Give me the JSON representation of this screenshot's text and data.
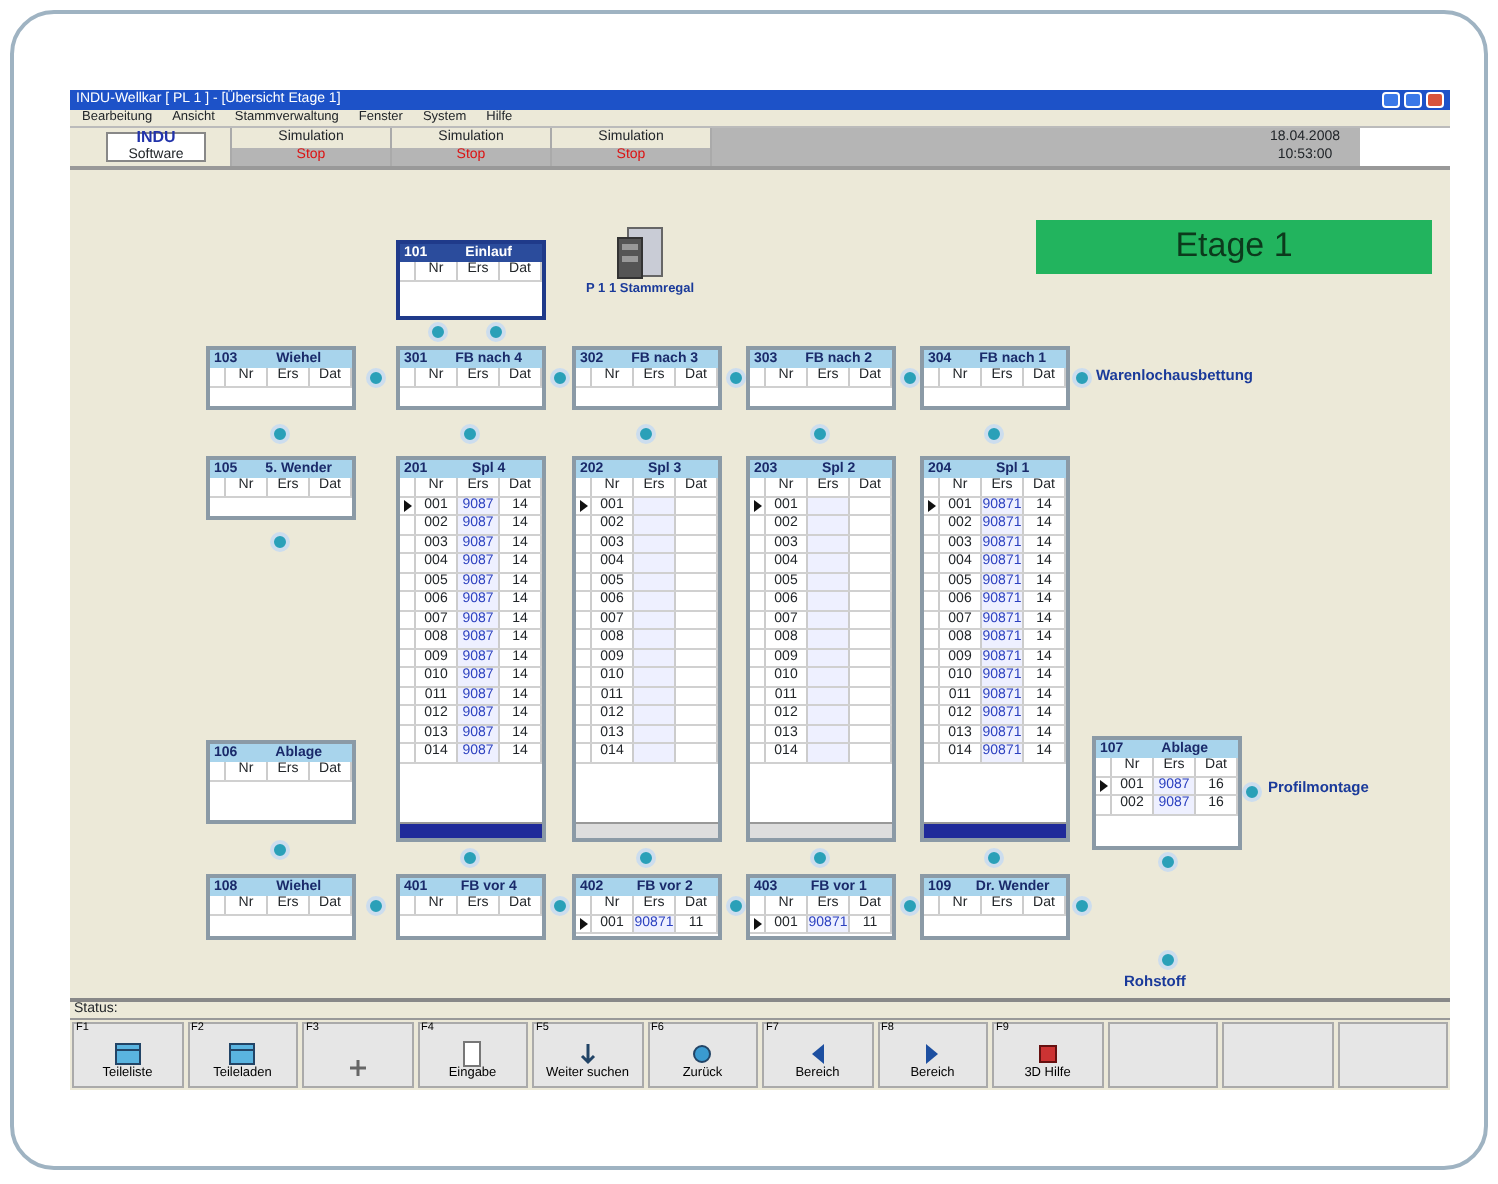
{
  "window": {
    "title": "INDU-Wellkar [ PL 1 ] - [Übersicht Etage 1]"
  },
  "menu": [
    "Bearbeitung",
    "Ansicht",
    "Stammverwaltung",
    "Fenster",
    "System",
    "Hilfe"
  ],
  "toolbar": {
    "logo": "INDU",
    "logo_sub": "Software",
    "modes": [
      {
        "label": "Simulation",
        "state": "Stop"
      },
      {
        "label": "Simulation",
        "state": "Stop"
      },
      {
        "label": "Simulation",
        "state": "Stop"
      }
    ],
    "date": "18.04.2008",
    "time": "10:53:00"
  },
  "floor": {
    "label": "Etage 1"
  },
  "storage": {
    "label": "P 1 1 Stammregal"
  },
  "labels": [
    {
      "kind": "right",
      "text": "Warenlochausbettung"
    },
    {
      "kind": "side",
      "text": "Profilmontage"
    },
    {
      "kind": "below",
      "text": "Rohstoff"
    }
  ],
  "nodes": [
    {
      "number": "101",
      "title": "Einlauf",
      "highlight": true,
      "columns": [
        "Nr",
        "Ers",
        "Dat"
      ]
    },
    {
      "number": "103",
      "title": "Wiehel",
      "highlight": false,
      "columns": [
        "Nr",
        "Ers",
        "Dat"
      ]
    },
    {
      "number": "301",
      "title": "FB nach 4",
      "highlight": false,
      "columns": [
        "Nr",
        "Ers",
        "Dat"
      ]
    },
    {
      "number": "302",
      "title": "FB nach 3",
      "highlight": false,
      "columns": [
        "Nr",
        "Ers",
        "Dat"
      ]
    },
    {
      "number": "303",
      "title": "FB nach 2",
      "highlight": false,
      "columns": [
        "Nr",
        "Ers",
        "Dat"
      ]
    },
    {
      "number": "304",
      "title": "FB nach 1",
      "highlight": false,
      "columns": [
        "Nr",
        "Ers",
        "Dat"
      ]
    },
    {
      "number": "105",
      "title": "5. Wender",
      "highlight": false,
      "columns": [
        "Nr",
        "Ers",
        "Dat"
      ]
    },
    {
      "number": "201",
      "title": "Spl 4",
      "highlight": false,
      "footer_active": true,
      "columns": [
        "Nr",
        "Ers",
        "Dat"
      ],
      "rows": [
        {
          "selected": true,
          "cells": [
            "001",
            "9087",
            "14"
          ]
        },
        {
          "selected": false,
          "cells": [
            "002",
            "9087",
            "14"
          ]
        },
        {
          "selected": false,
          "cells": [
            "003",
            "9087",
            "14"
          ]
        },
        {
          "selected": false,
          "cells": [
            "004",
            "9087",
            "14"
          ]
        },
        {
          "selected": false,
          "cells": [
            "005",
            "9087",
            "14"
          ]
        },
        {
          "selected": false,
          "cells": [
            "006",
            "9087",
            "14"
          ]
        },
        {
          "selected": false,
          "cells": [
            "007",
            "9087",
            "14"
          ]
        },
        {
          "selected": false,
          "cells": [
            "008",
            "9087",
            "14"
          ]
        },
        {
          "selected": false,
          "cells": [
            "009",
            "9087",
            "14"
          ]
        },
        {
          "selected": false,
          "cells": [
            "010",
            "9087",
            "14"
          ]
        },
        {
          "selected": false,
          "cells": [
            "011",
            "9087",
            "14"
          ]
        },
        {
          "selected": false,
          "cells": [
            "012",
            "9087",
            "14"
          ]
        },
        {
          "selected": false,
          "cells": [
            "013",
            "9087",
            "14"
          ]
        },
        {
          "selected": false,
          "cells": [
            "014",
            "9087",
            "14"
          ]
        }
      ]
    },
    {
      "number": "202",
      "title": "Spl 3",
      "highlight": false,
      "footer_active": false,
      "columns": [
        "Nr",
        "Ers",
        "Dat"
      ],
      "rows": [
        {
          "selected": true,
          "cells": [
            "001"
          ]
        },
        {
          "selected": false,
          "cells": [
            "002"
          ]
        },
        {
          "selected": false,
          "cells": [
            "003"
          ]
        },
        {
          "selected": false,
          "cells": [
            "004"
          ]
        },
        {
          "selected": false,
          "cells": [
            "005"
          ]
        },
        {
          "selected": false,
          "cells": [
            "006"
          ]
        },
        {
          "selected": false,
          "cells": [
            "007"
          ]
        },
        {
          "selected": false,
          "cells": [
            "008"
          ]
        },
        {
          "selected": false,
          "cells": [
            "009"
          ]
        },
        {
          "selected": false,
          "cells": [
            "010"
          ]
        },
        {
          "selected": false,
          "cells": [
            "011"
          ]
        },
        {
          "selected": false,
          "cells": [
            "012"
          ]
        },
        {
          "selected": false,
          "cells": [
            "013"
          ]
        },
        {
          "selected": false,
          "cells": [
            "014"
          ]
        }
      ]
    },
    {
      "number": "203",
      "title": "Spl 2",
      "highlight": false,
      "footer_active": false,
      "columns": [
        "Nr",
        "Ers",
        "Dat"
      ],
      "rows": [
        {
          "selected": true,
          "cells": [
            "001"
          ]
        },
        {
          "selected": false,
          "cells": [
            "002"
          ]
        },
        {
          "selected": false,
          "cells": [
            "003"
          ]
        },
        {
          "selected": false,
          "cells": [
            "004"
          ]
        },
        {
          "selected": false,
          "cells": [
            "005"
          ]
        },
        {
          "selected": false,
          "cells": [
            "006"
          ]
        },
        {
          "selected": false,
          "cells": [
            "007"
          ]
        },
        {
          "selected": false,
          "cells": [
            "008"
          ]
        },
        {
          "selected": false,
          "cells": [
            "009"
          ]
        },
        {
          "selected": false,
          "cells": [
            "010"
          ]
        },
        {
          "selected": false,
          "cells": [
            "011"
          ]
        },
        {
          "selected": false,
          "cells": [
            "012"
          ]
        },
        {
          "selected": false,
          "cells": [
            "013"
          ]
        },
        {
          "selected": false,
          "cells": [
            "014"
          ]
        }
      ]
    },
    {
      "number": "204",
      "title": "Spl 1",
      "highlight": false,
      "footer_active": true,
      "columns": [
        "Nr",
        "Ers",
        "Dat"
      ],
      "rows": [
        {
          "selected": true,
          "cells": [
            "001",
            "90871",
            "14"
          ]
        },
        {
          "selected": false,
          "cells": [
            "002",
            "90871",
            "14"
          ]
        },
        {
          "selected": false,
          "cells": [
            "003",
            "90871",
            "14"
          ]
        },
        {
          "selected": false,
          "cells": [
            "004",
            "90871",
            "14"
          ]
        },
        {
          "selected": false,
          "cells": [
            "005",
            "90871",
            "14"
          ]
        },
        {
          "selected": false,
          "cells": [
            "006",
            "90871",
            "14"
          ]
        },
        {
          "selected": false,
          "cells": [
            "007",
            "90871",
            "14"
          ]
        },
        {
          "selected": false,
          "cells": [
            "008",
            "90871",
            "14"
          ]
        },
        {
          "selected": false,
          "cells": [
            "009",
            "90871",
            "14"
          ]
        },
        {
          "selected": false,
          "cells": [
            "010",
            "90871",
            "14"
          ]
        },
        {
          "selected": false,
          "cells": [
            "011",
            "90871",
            "14"
          ]
        },
        {
          "selected": false,
          "cells": [
            "012",
            "90871",
            "14"
          ]
        },
        {
          "selected": false,
          "cells": [
            "013",
            "90871",
            "14"
          ]
        },
        {
          "selected": false,
          "cells": [
            "014",
            "90871",
            "14"
          ]
        }
      ]
    },
    {
      "number": "106",
      "title": "Ablage",
      "highlight": false,
      "columns": [
        "Nr",
        "Ers",
        "Dat"
      ]
    },
    {
      "number": "107",
      "title": "Ablage",
      "highlight": false,
      "columns": [
        "Nr",
        "Ers",
        "Dat"
      ],
      "rows": [
        {
          "selected": true,
          "cells": [
            "001",
            "9087",
            "16"
          ]
        },
        {
          "selected": false,
          "cells": [
            "002",
            "9087",
            "16"
          ]
        }
      ]
    },
    {
      "number": "108",
      "title": "Wiehel",
      "highlight": false,
      "columns": [
        "Nr",
        "Ers",
        "Dat"
      ]
    },
    {
      "number": "401",
      "title": "FB vor 4",
      "highlight": false,
      "columns": [
        "Nr",
        "Ers",
        "Dat"
      ]
    },
    {
      "number": "402",
      "title": "FB vor 2",
      "highlight": false,
      "columns": [
        "Nr",
        "Ers",
        "Dat"
      ],
      "rows": [
        {
          "selected": true,
          "cells": [
            "001",
            "90871",
            "11"
          ]
        }
      ]
    },
    {
      "number": "403",
      "title": "FB vor 1",
      "highlight": false,
      "columns": [
        "Nr",
        "Ers",
        "Dat"
      ],
      "rows": [
        {
          "selected": true,
          "cells": [
            "001",
            "90871",
            "11"
          ]
        }
      ]
    },
    {
      "number": "109",
      "title": "Dr. Wender",
      "highlight": false,
      "columns": [
        "Nr",
        "Ers",
        "Dat"
      ]
    }
  ],
  "status_bar": {
    "label": "Status:"
  },
  "function_keys": [
    {
      "key": "F1",
      "label": "Teileliste"
    },
    {
      "key": "F2",
      "label": "Teileladen"
    },
    {
      "key": "F3"
    },
    {
      "key": "F4",
      "label": "Eingabe"
    },
    {
      "key": "F5",
      "label": "Weiter suchen"
    },
    {
      "key": "F6",
      "label": "Zurück"
    },
    {
      "key": "F7",
      "label": "Bereich"
    },
    {
      "key": "F8",
      "label": "Bereich"
    },
    {
      "key": "F9",
      "label": "3D Hilfe"
    }
  ]
}
